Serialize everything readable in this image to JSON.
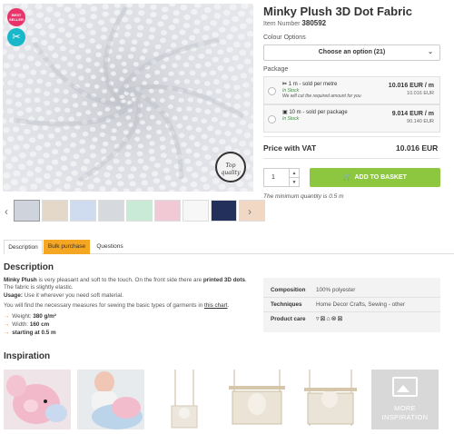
{
  "product": {
    "title": "Minky Plush 3D Dot Fabric",
    "item_number_label": "Item Number",
    "item_number": "380592"
  },
  "badges": {
    "best": "BEST SELLER",
    "tool_icon": "scissors-icon",
    "seal_text": "Top quality"
  },
  "colour": {
    "label": "Colour Options",
    "placeholder": "Choose an option (21)"
  },
  "package": {
    "label": "Package",
    "options": [
      {
        "name": "1 m - sold per metre",
        "stock": "In Stock",
        "note": "We will cut the required amount for you",
        "price": "10.016 EUR / m",
        "sub": "10.016 EUR"
      },
      {
        "name": "10 m - sold per package",
        "stock": "In Stock",
        "note": "",
        "price": "9.014 EUR / m",
        "sub": "90.140 EUR"
      }
    ]
  },
  "price": {
    "label": "Price with VAT",
    "value": "10.016 EUR"
  },
  "cart": {
    "quantity": "1",
    "button": "ADD TO BASKET",
    "min_qty": "The minimum quantity is 0.5 m"
  },
  "thumbnails": [
    "#cfd3db",
    "#e4d9c9",
    "#cfdcef",
    "#d6dade",
    "#c9ead7",
    "#f1c9d5",
    "#f7f7f7",
    "#24305c",
    "#f1d8c4"
  ],
  "tabs": [
    "Description",
    "Bulk purchase",
    "Questions"
  ],
  "description": {
    "heading": "Description",
    "p1_bold": "Minky Plush",
    "p1_a": " is very pleasant and soft to the touch. On the front side there are ",
    "p1_bold2": "printed 3D dots",
    "p1_b": ". The fabric is slightly elastic.",
    "usage_label": "Usage:",
    "usage": " Use it wherever you need soft material.",
    "chart_pre": "You will find the necessary measures for sewing the basic types of garments in ",
    "chart_link": "this chart",
    "chart_post": ".",
    "bullets": [
      {
        "label": "Weight: ",
        "value": "380 g/m²"
      },
      {
        "label": "Width: ",
        "value": "160 cm"
      },
      {
        "label": "",
        "value": "starting at 0.5 m"
      }
    ]
  },
  "specs": [
    {
      "key": "Composition",
      "value": "100% polyester"
    },
    {
      "key": "Techniques",
      "value": "Home Decor Crafts, Sewing - other"
    },
    {
      "key": "Product care",
      "value": ""
    }
  ],
  "care_icons": [
    "wash-30-icon",
    "no-bleach-icon",
    "no-iron-icon",
    "no-dry-clean-icon",
    "no-tumble-dry-icon"
  ],
  "inspiration": {
    "heading": "Inspiration",
    "more_line1": "MORE",
    "more_line2": "INSPIRATION"
  }
}
